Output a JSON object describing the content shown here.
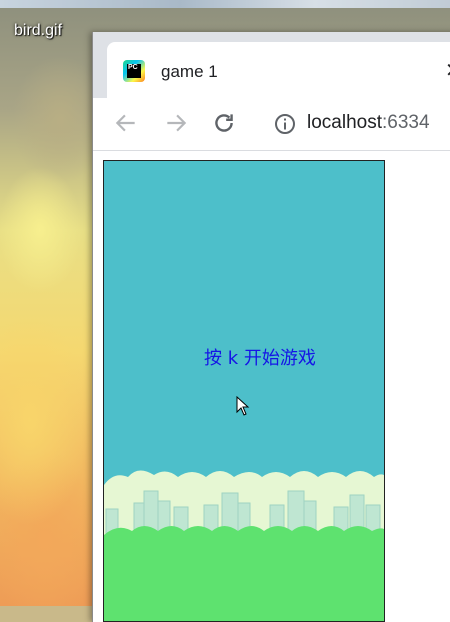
{
  "desktop": {
    "label": "bird.gif"
  },
  "browser": {
    "tab": {
      "title": "game 1",
      "favicon": "pycharm-icon",
      "close_icon": "close-icon"
    },
    "toolbar": {
      "back_icon": "back-arrow-icon",
      "forward_icon": "forward-arrow-icon",
      "reload_icon": "reload-icon",
      "info_icon": "info-icon",
      "url_host": "localhost",
      "url_port": ":6334"
    }
  },
  "game": {
    "start_prompt": "按 k 开始游戏",
    "sky_color": "#4dbfca",
    "ground_color": "#5ee26f",
    "cloud_color": "#e6f7d3",
    "text_color": "#1515e6"
  }
}
